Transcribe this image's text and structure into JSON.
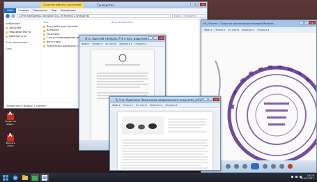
{
  "explorer": {
    "title": "Тунеядства",
    "context_tab": "Средства работы с рисунками",
    "tabs": [
      "Файл",
      "Главная",
      "Поделиться",
      "Вид",
      "Управление"
    ],
    "address": "▸ Этот компьютер ▸ Загрузки (D:) ▸ Ilf/ Portfolio ▸ Тунеядства",
    "search_placeholder": "Поиск: Тунеядства",
    "nav": {
      "favorites": "Избранное",
      "items": [
        "Загрузки",
        "Недавние места",
        "Рабочий стол"
      ],
      "this_pc": "Этот компьютер",
      "network": "Сеть"
    },
    "columns": [
      "Имя",
      "Дата изменения",
      "Тип",
      "Размер"
    ],
    "files": [
      "Все учебн. для занятий",
      "Каталоги",
      "Рецензии",
      "Статус преподавания работ...",
      "Фото горы",
      "Числительс.артикуры, титуло..."
    ],
    "status": "Элементов: 6   Выбран 1 элемент"
  },
  "docwin": {
    "title": "Отз. Заистей гипертр. Р 3 о муз. издатели...",
    "menu": [
      "Файл ▾",
      "Печать ▾",
      "Эл. почта",
      "Записать ▾",
      "Открыть ▾"
    ]
  },
  "photo": {
    "title": "09_Печатка - Средство просмотра фотографий Windows",
    "menu": [
      "Файл ▾",
      "Печать ▾",
      "Эл. почта",
      "Записать ▾",
      "Открыть ▾"
    ]
  },
  "frontwin": {
    "title": "В_Ч он Одесское Замечание современного искусства_2017...",
    "menu": [
      "Файл ▾",
      "Печать ▾",
      "Эл. почта",
      "Записать ▾",
      "Открыть ▾"
    ]
  },
  "desktop_icons": [
    {
      "label": "Запрет на объек..."
    },
    {
      "label": "Выход в Adobe"
    }
  ],
  "tray": {
    "time": "14:25",
    "date": "10.05.2017"
  },
  "colors": {
    "accent": "#1a6cc4",
    "stamp": "#5b2d8c",
    "close": "#c84a3a"
  }
}
